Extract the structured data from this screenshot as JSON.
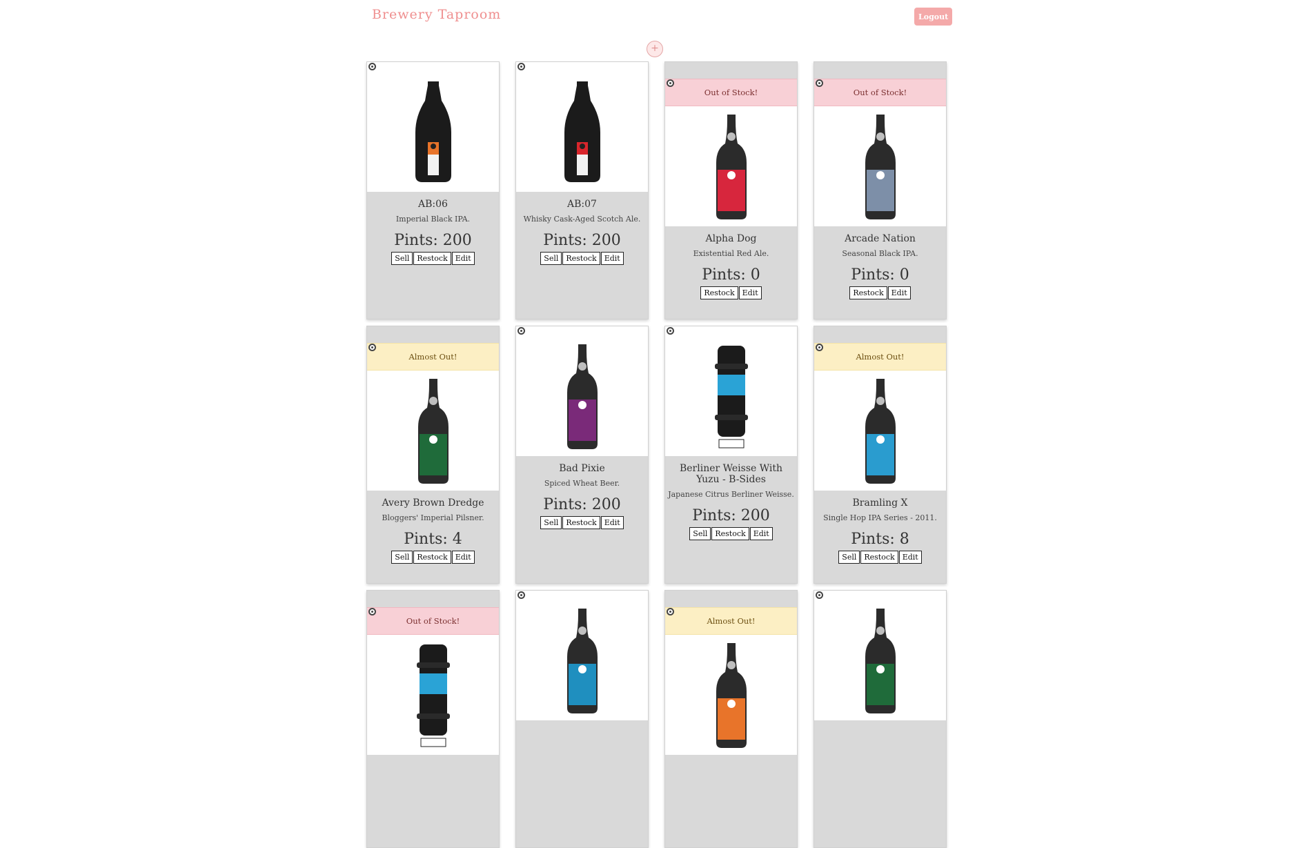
{
  "header": {
    "brand": "Brewery Taproom",
    "logout_label": "Logout",
    "add_icon": "+"
  },
  "cards": [
    {
      "name": "AB:06",
      "desc": "Imperial Black IPA.",
      "pints": "Pints: 200",
      "status": "",
      "sell": "Sell",
      "restock": "Restock",
      "edit": "Edit",
      "label_color": "#e8742a",
      "style": "champagne"
    },
    {
      "name": "AB:07",
      "desc": "Whisky Cask-Aged Scotch Ale.",
      "pints": "Pints: 200",
      "status": "",
      "sell": "Sell",
      "restock": "Restock",
      "edit": "Edit",
      "label_color": "#d9262c",
      "style": "champagne"
    },
    {
      "name": "Alpha Dog",
      "desc": "Existential Red Ale.",
      "pints": "Pints: 0",
      "status": "Out of Stock!",
      "sell": "",
      "restock": "Restock",
      "edit": "Edit",
      "label_color": "#d7263d",
      "style": "bottle"
    },
    {
      "name": "Arcade Nation",
      "desc": "Seasonal Black IPA.",
      "pints": "Pints: 0",
      "status": "Out of Stock!",
      "sell": "",
      "restock": "Restock",
      "edit": "Edit",
      "label_color": "#7d8fa8",
      "style": "bottle"
    },
    {
      "name": "Avery Brown Dredge",
      "desc": "Bloggers' Imperial Pilsner.",
      "pints": "Pints: 4",
      "status": "Almost Out!",
      "sell": "Sell",
      "restock": "Restock",
      "edit": "Edit",
      "label_color": "#1f6b3a",
      "style": "bottle"
    },
    {
      "name": "Bad Pixie",
      "desc": "Spiced Wheat Beer.",
      "pints": "Pints: 200",
      "status": "",
      "sell": "Sell",
      "restock": "Restock",
      "edit": "Edit",
      "label_color": "#7a2a79",
      "style": "bottle"
    },
    {
      "name": "Berliner Weisse With Yuzu - B-Sides",
      "desc": "Japanese Citrus Berliner Weisse.",
      "pints": "Pints: 200",
      "status": "",
      "sell": "Sell",
      "restock": "Restock",
      "edit": "Edit",
      "label_color": "#2aa3d6",
      "style": "keg"
    },
    {
      "name": "Bramling X",
      "desc": "Single Hop IPA Series - 2011.",
      "pints": "Pints: 8",
      "status": "Almost Out!",
      "sell": "Sell",
      "restock": "Restock",
      "edit": "Edit",
      "label_color": "#2a9ccf",
      "style": "bottle"
    },
    {
      "name": "",
      "desc": "",
      "pints": "",
      "status": "Out of Stock!",
      "sell": "",
      "restock": "",
      "edit": "",
      "label_color": "#2aa3d6",
      "style": "keg"
    },
    {
      "name": "",
      "desc": "",
      "pints": "",
      "status": "",
      "sell": "",
      "restock": "",
      "edit": "",
      "label_color": "#1f8fbf",
      "style": "bottle"
    },
    {
      "name": "",
      "desc": "",
      "pints": "",
      "status": "Almost Out!",
      "sell": "",
      "restock": "",
      "edit": "",
      "label_color": "#e8742a",
      "style": "bottle"
    },
    {
      "name": "",
      "desc": "",
      "pints": "",
      "status": "",
      "sell": "",
      "restock": "",
      "edit": "",
      "label_color": "#1f6b3a",
      "style": "bottle"
    }
  ]
}
